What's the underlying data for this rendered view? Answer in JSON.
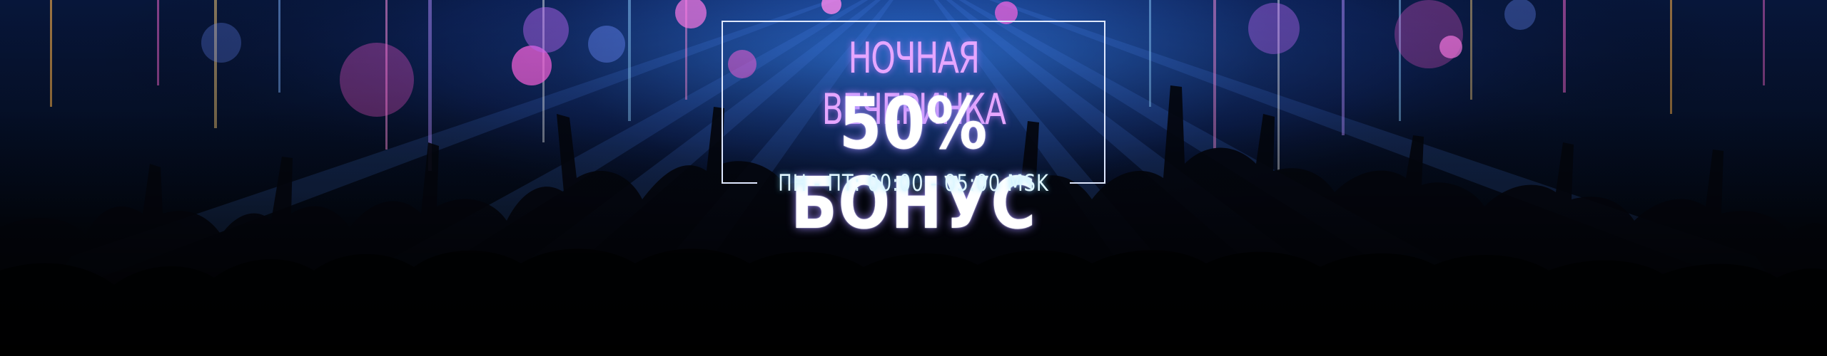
{
  "promo": {
    "title": "НОЧНАЯ ВЕЧЕРИНКА",
    "bonus": "50% БОНУС",
    "schedule": "ПН - ПТ: 00:00 - 05:00 MSK"
  },
  "colors": {
    "title": "#e6a6ff",
    "bonus": "#ffffff",
    "schedule": "#dff7ff",
    "frame": "#dfe8ff",
    "background_top": "#07163a",
    "background_bottom": "#010203"
  }
}
